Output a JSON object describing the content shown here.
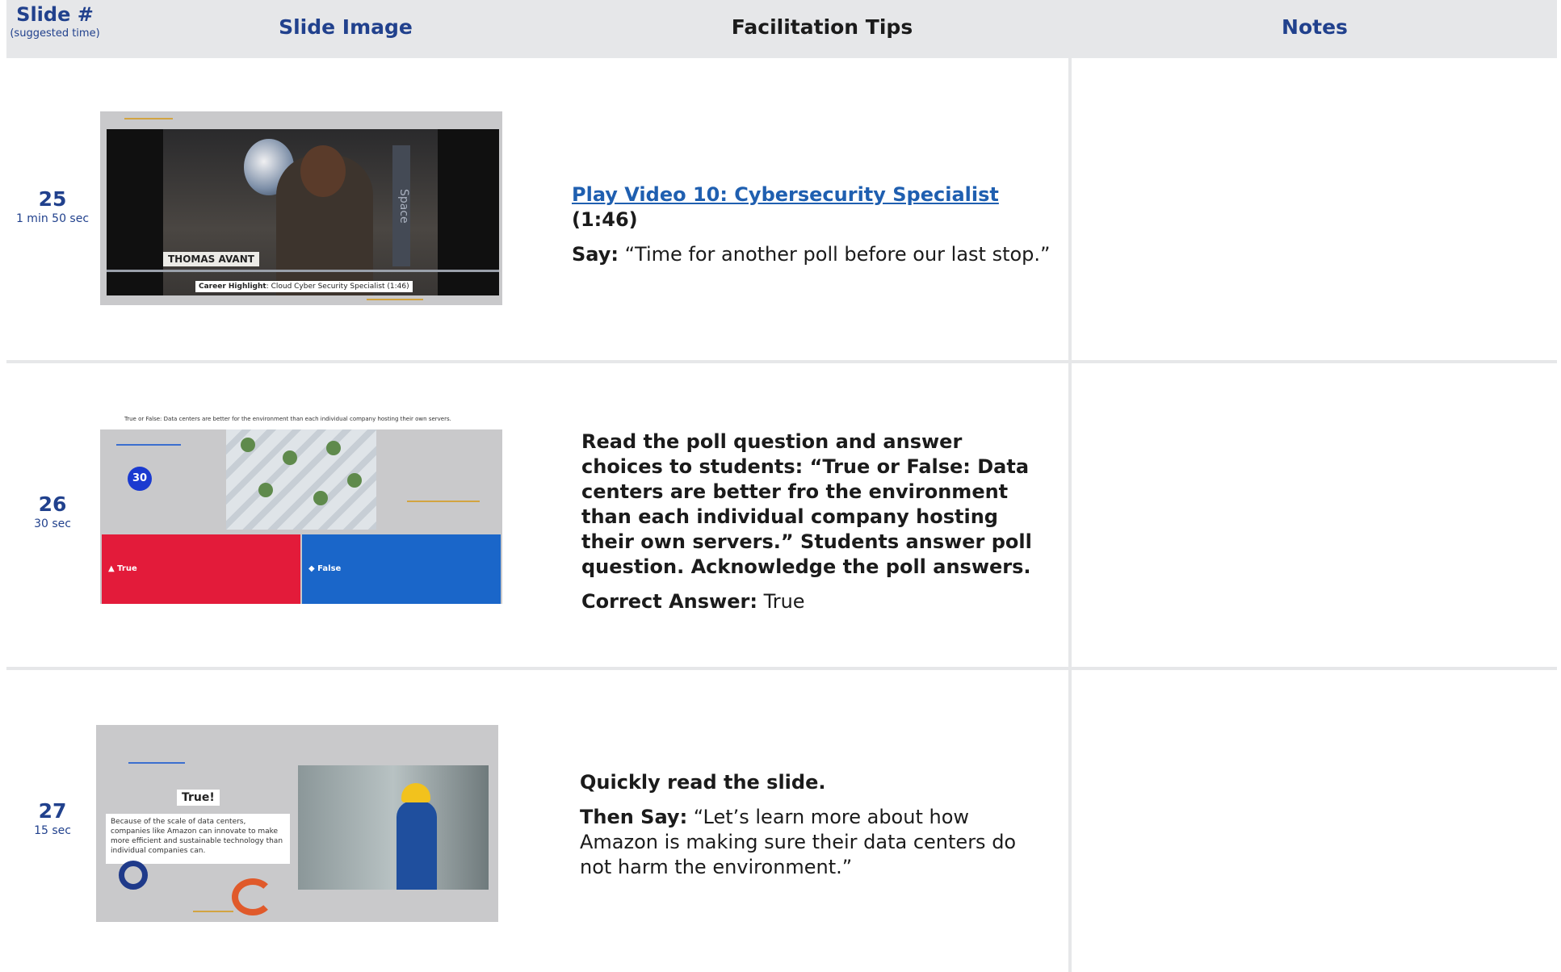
{
  "header": {
    "slide_label": "Slide #",
    "slide_sub": "(suggested time)",
    "image_label": "Slide Image",
    "tips_label": "Facilitation Tips",
    "notes_label": "Notes"
  },
  "rows": [
    {
      "number": "25",
      "duration": "1 min 50 sec",
      "thumb": {
        "presenter_name": "THOMAS AVANT",
        "backdrop_text": "Space",
        "caption_bold": "Career Highlight",
        "caption_rest": ": Cloud Cyber Security Specialist (1:46)"
      },
      "link_text": "Play Video 10: Cybersecurity Specialist",
      "link_suffix": " (1:46)",
      "say_label": "Say:",
      "say_text": " “Time for another poll before our last stop.”"
    },
    {
      "number": "26",
      "duration": "30 sec",
      "thumb": {
        "question": "True or False: Data centers are better for the environment than each individual company hosting their own servers.",
        "timer": "30",
        "option_true": "▲ True",
        "option_false": "◆ False"
      },
      "instruction": "Read the poll question and answer choices to students: “True or False: Data centers are better fro the environment than each individual company hosting their own servers.” Students answer poll question. Acknowledge the poll answers.",
      "answer_label": "Correct Answer:",
      "answer_value": " True"
    },
    {
      "number": "27",
      "duration": "15 sec",
      "thumb": {
        "label": "True!",
        "body": "Because of the scale of data centers, companies like Amazon can innovate to make more efficient and sustainable technology than individual companies can."
      },
      "instruction": "Quickly read the slide.",
      "say_label": "Then Say:",
      "say_text": " “Let’s learn more about how Amazon is making sure their data centers do not harm the environment.”"
    }
  ]
}
